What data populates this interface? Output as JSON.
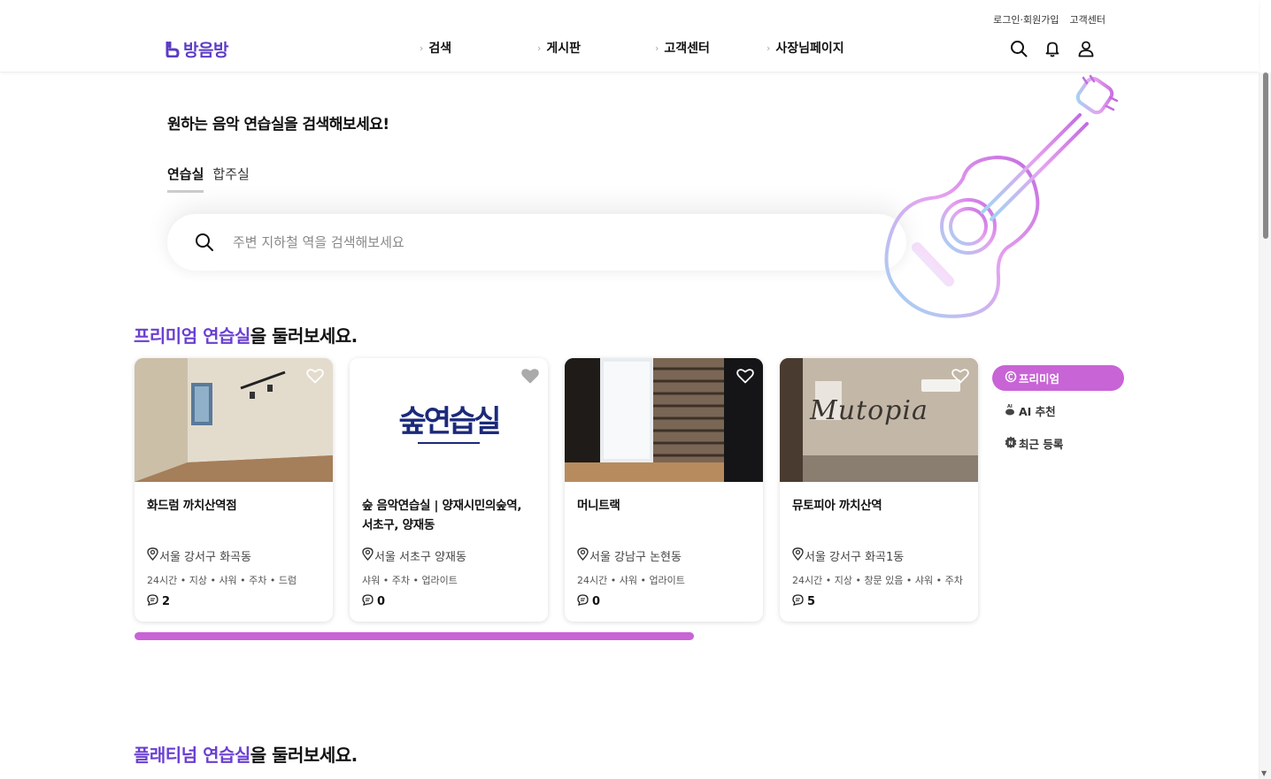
{
  "header": {
    "logo_text": "방음방",
    "utility_links": [
      "로그인·회원가입",
      "고객센터"
    ],
    "nav": [
      "검색",
      "게시판",
      "고객센터",
      "사장님페이지"
    ],
    "icons": [
      "search-icon",
      "bell-icon",
      "user-icon"
    ]
  },
  "hero": {
    "title": "원하는 음악 연습실을 검색해보세요!",
    "tabs": [
      "연습실",
      "합주실"
    ],
    "active_tab": "연습실",
    "search_placeholder": "주변 지하철 역을 검색해보세요"
  },
  "premium": {
    "title_accent": "프리미엄 연습실",
    "title_rest": "을 둘러보세요.",
    "cards": [
      {
        "name": "화드럼 까치산역점",
        "address": "서울 강서구 화곡동",
        "tags": "24시간 • 지상 • 샤워 • 주차 • 드럼",
        "reviews": "2"
      },
      {
        "name": "숲 음악연습실 | 양재시민의숲역, 서초구, 양재동",
        "address": "서울 서초구 양재동",
        "tags": "샤워 • 주차 • 업라이트",
        "reviews": "0",
        "logo_text": "숲연습실"
      },
      {
        "name": "머니트랙",
        "address": "서울 강남구 논현동",
        "tags": "24시간 • 샤워 • 업라이트",
        "reviews": "0"
      },
      {
        "name": "뮤토피아 까치산역",
        "address": "서울 강서구 화곡1동",
        "tags": "24시간 • 지상 • 창문 있음 • 샤워 • 주차",
        "reviews": "5",
        "logo_text": "Mutopia"
      }
    ],
    "filters": [
      "프리미엄",
      "AI 추천",
      "최근 등록"
    ],
    "active_filter": "프리미엄",
    "progress_fraction": 0.67
  },
  "platinum": {
    "title_accent": "플래티넘 연습실",
    "title_rest": "을 둘러보세요."
  },
  "colors": {
    "brand": "#5b3cc4",
    "accent_text": "#6b3fd1",
    "filter_active": "#c864d6",
    "guitar_gradient": [
      "#c36ce0",
      "#e7a0f0",
      "#9fd6f2"
    ]
  }
}
